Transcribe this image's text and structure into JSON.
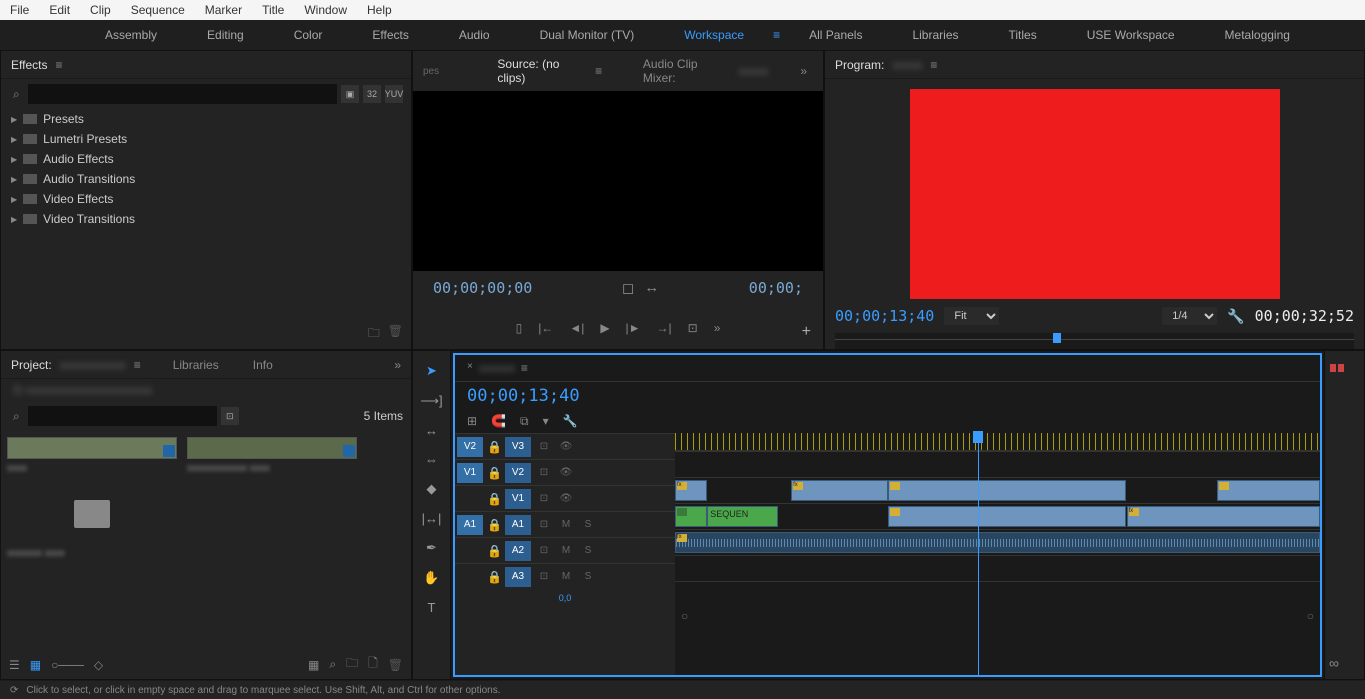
{
  "menu": [
    "File",
    "Edit",
    "Clip",
    "Sequence",
    "Marker",
    "Title",
    "Window",
    "Help"
  ],
  "workspaces": {
    "items": [
      "Assembly",
      "Editing",
      "Color",
      "Effects",
      "Audio",
      "Dual Monitor (TV)",
      "Workspace",
      "All Panels",
      "Libraries",
      "Titles",
      "USE Workspace",
      "Metalogging"
    ],
    "active_index": 6
  },
  "effects": {
    "title": "Effects",
    "search_placeholder": "",
    "search_icon": "⌕",
    "badges": [
      "▣",
      "32",
      "YUV"
    ],
    "folders": [
      "Presets",
      "Lumetri Presets",
      "Audio Effects",
      "Audio Transitions",
      "Video Effects",
      "Video Transitions"
    ]
  },
  "source": {
    "title": "Source: (no clips)",
    "mixer_title": "Audio Clip Mixer:",
    "tc_in": "00;00;00;00",
    "tc_out": "00;00;"
  },
  "program": {
    "title": "Program:",
    "tc_current": "00;00;13;40",
    "fit_label": "Fit",
    "quality_label": "1/4",
    "tc_duration": "00;00;32;52"
  },
  "project": {
    "title": "Project:",
    "libraries_tab": "Libraries",
    "info_tab": "Info",
    "items_count": "5 Items",
    "search_placeholder": "",
    "search_icon": "⌕"
  },
  "timeline": {
    "tc": "00;00;13;40",
    "tracks": {
      "v2_src": "V2",
      "v3": "V3",
      "v1_src": "V1",
      "v2": "V2",
      "v1": "V1",
      "a1_src": "A1",
      "a1": "A1",
      "a2": "A2",
      "a3": "A3"
    },
    "seq_label": "SEQUEN",
    "zoom_tc": "0,0"
  },
  "status": "Click to select, or click in empty space and drag to marquee select. Use Shift, Alt, and Ctrl for other options."
}
